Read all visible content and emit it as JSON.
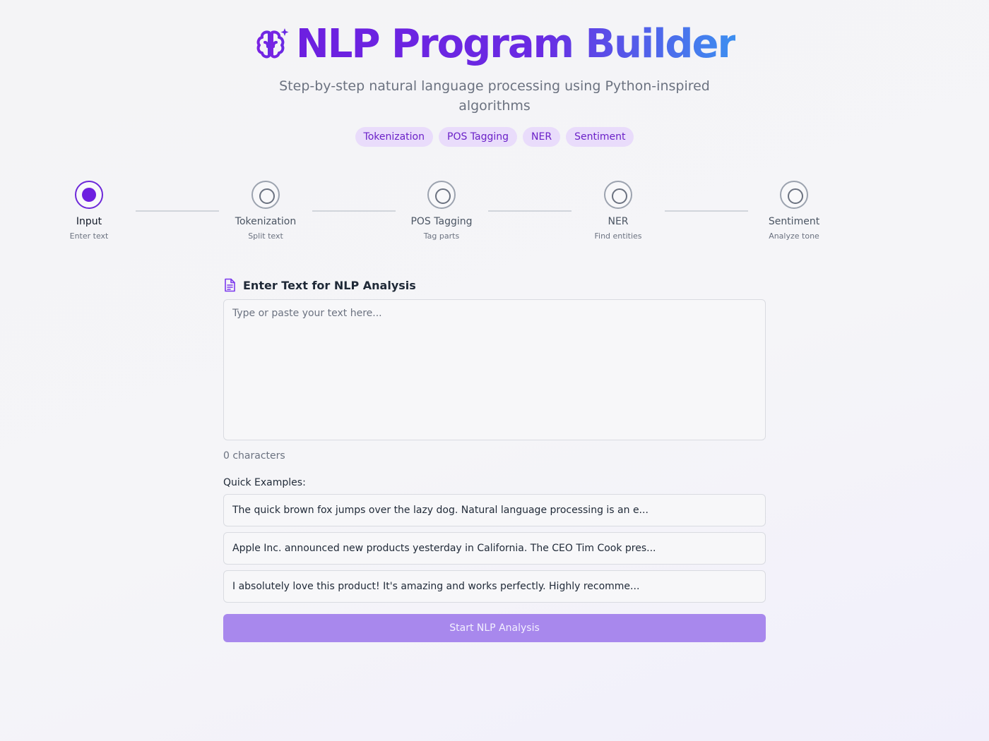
{
  "header": {
    "title": "NLP Program Builder",
    "subtitle": "Step-by-step natural language processing using Python-inspired algorithms",
    "tags": [
      "Tokenization",
      "POS Tagging",
      "NER",
      "Sentiment"
    ]
  },
  "steps": [
    {
      "label": "Input",
      "sub": "Enter text",
      "active": true
    },
    {
      "label": "Tokenization",
      "sub": "Split text",
      "active": false
    },
    {
      "label": "POS Tagging",
      "sub": "Tag parts",
      "active": false
    },
    {
      "label": "NER",
      "sub": "Find entities",
      "active": false
    },
    {
      "label": "Sentiment",
      "sub": "Analyze tone",
      "active": false
    }
  ],
  "input": {
    "section_title": "Enter Text for NLP Analysis",
    "placeholder": "Type or paste your text here...",
    "value": "",
    "char_count": "0 characters"
  },
  "examples": {
    "title": "Quick Examples:",
    "items": [
      "The quick brown fox jumps over the lazy dog. Natural language processing is an e...",
      "Apple Inc. announced new products yesterday in California. The CEO Tim Cook pres...",
      "I absolutely love this product! It's amazing and works perfectly. Highly recomme..."
    ]
  },
  "actions": {
    "start_label": "Start NLP Analysis"
  },
  "icons": {
    "title_icon": "brain-sparkle-icon",
    "section_icon": "document-icon"
  },
  "colors": {
    "accent": "#6d1fe0",
    "title_gradient_end": "#3d8ff0",
    "tag_bg": "#e9dcfb",
    "button_bg": "#a888ed"
  }
}
